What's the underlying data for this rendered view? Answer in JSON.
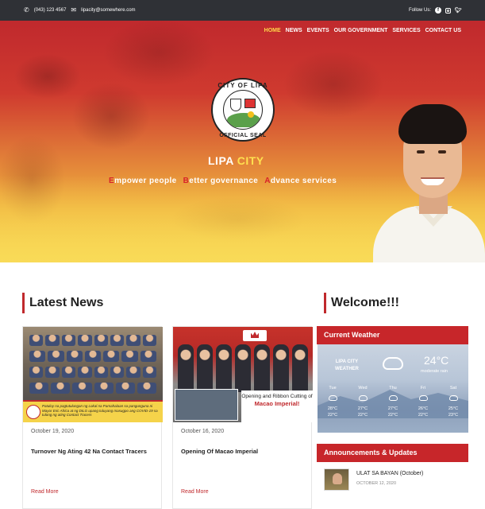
{
  "topbar": {
    "phone": "(043) 123 4567",
    "email": "lipacity@somewhere.com",
    "follow_label": "Follow Us:",
    "social_icons": [
      "facebook-icon",
      "instagram-icon",
      "twitter-icon"
    ]
  },
  "nav": {
    "items": [
      "HOME",
      "NEWS",
      "EVENTS",
      "OUR GOVERNMENT",
      "SERVICES",
      "CONTACT US"
    ],
    "active": "HOME"
  },
  "hero": {
    "seal_top": "CITY OF LIPA",
    "seal_bottom": "OFFICIAL SEAL",
    "city_name_1": "LIPA",
    "city_name_2": "CITY",
    "tagline": [
      {
        "initial": "E",
        "rest": "mpower people"
      },
      {
        "initial": "B",
        "rest": "etter governance"
      },
      {
        "initial": "A",
        "rest": "dvance services"
      }
    ]
  },
  "news": {
    "heading": "Latest News",
    "cards": [
      {
        "date": "October 19, 2020",
        "title": "Turnover Ng Ating 42 Na Contact Tracers",
        "more": "Read More",
        "image_caption": "Patuloy na pagtutulungan ng Lokal na Pamahalaan sa pangunguna ni Mayor Eric Africa at ng DILG upang tuluyang masugpo ang COVID-19 sa tulong ng ating Contact Tracers"
      },
      {
        "date": "October 16, 2020",
        "title": "Opening Of Macao Imperial",
        "more": "Read More",
        "image_caption_1": "Opening and Ribbon Cutting of",
        "image_caption_2": "Macao Imperial!"
      }
    ]
  },
  "sidebar": {
    "heading": "Welcome!!!",
    "weather": {
      "title": "Current Weather",
      "location_1": "LIPA CITY",
      "location_2": "WEATHER",
      "temp": "24°C",
      "condition": "moderate rain",
      "days": [
        {
          "name": "Tue",
          "hi": "28°C",
          "lo": "22°C"
        },
        {
          "name": "Wed",
          "hi": "27°C",
          "lo": "22°C"
        },
        {
          "name": "Thu",
          "hi": "27°C",
          "lo": "22°C"
        },
        {
          "name": "Fri",
          "hi": "26°C",
          "lo": "22°C"
        },
        {
          "name": "Sat",
          "hi": "25°C",
          "lo": "23°C"
        }
      ]
    },
    "announcements": {
      "title": "Announcements & Updates",
      "items": [
        {
          "title": "ULAT SA BAYAN (October)",
          "date": "OCTOBER 12, 2020"
        }
      ]
    }
  },
  "colors": {
    "brand_red": "#c7262a",
    "accent_yellow": "#ffd84a",
    "topbar_bg": "#2f3136"
  }
}
